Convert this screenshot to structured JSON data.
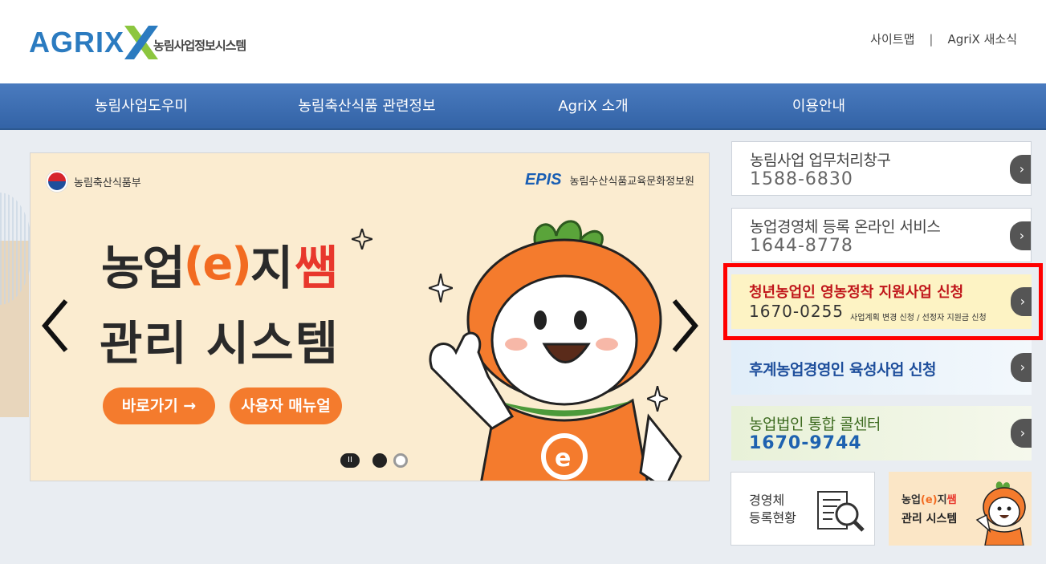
{
  "header": {
    "logo_text": "AGRIX",
    "logo_subtitle": "농림사업정보시스템",
    "util_links": [
      "사이트맵",
      "AgriX 새소식"
    ],
    "separator": "|"
  },
  "nav": {
    "items": [
      "농림사업도우미",
      "농림축산식품 관련정보",
      "AgriX 소개",
      "이용안내"
    ]
  },
  "banner": {
    "ministry": "농림축산식품부",
    "epis_logo": "EPIS",
    "epis_name": "농림수산식품교육문화정보원",
    "title_part1": "농업",
    "title_e": "(e)",
    "title_part2": "지",
    "title_ssam": "쌤",
    "title_line2": "관리 시스템",
    "btn_go": "바로가기 →",
    "btn_manual": "사용자 매뉴얼",
    "prev_arrow": "chevron-left-icon",
    "next_arrow": "chevron-right-icon",
    "pause_label": "II",
    "slide_index": 1,
    "slide_count": 2
  },
  "services": [
    {
      "title": "농림사업 업무처리창구",
      "number": "1588-6830"
    },
    {
      "title": "농업경영체 등록 온라인 서비스",
      "number": "1644-8778"
    },
    {
      "title": "청년농업인 영농정착 지원사업 신청",
      "number": "1670-0255",
      "sub": "사업계획 변경 신청 / 선정자 지원금 신청"
    },
    {
      "title": "후계농업경영인 육성사업 신청"
    },
    {
      "title": "농업법인 통합 콜센터",
      "number": "1670-9744"
    }
  ],
  "go_glyph": "›",
  "boxes": {
    "status_line1": "경영체",
    "status_line2": "등록현황",
    "promo_a": "농업",
    "promo_e": "(e)",
    "promo_b": "지",
    "promo_s": "쌤",
    "promo_line2": "관리 시스템"
  },
  "colors": {
    "nav_bg": "#3d6fb3",
    "highlight_border": "#ff0000",
    "accent_orange": "#f47b2d",
    "youth_title": "#c0151a"
  }
}
